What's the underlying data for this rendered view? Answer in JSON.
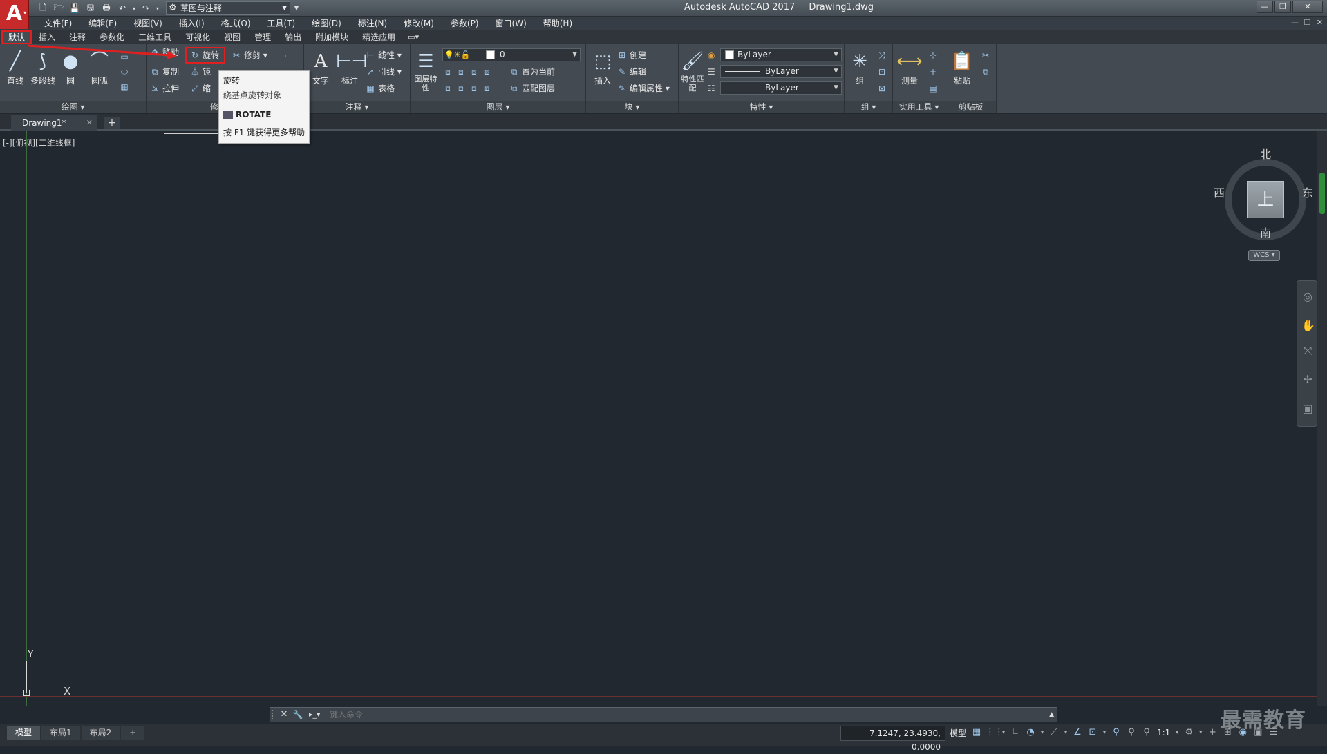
{
  "app": {
    "logo_letter": "A",
    "title": "Autodesk AutoCAD 2017",
    "file": "Drawing1.dwg",
    "workspace": "草图与注释"
  },
  "menu": [
    "文件(F)",
    "编辑(E)",
    "视图(V)",
    "插入(I)",
    "格式(O)",
    "工具(T)",
    "绘图(D)",
    "标注(N)",
    "修改(M)",
    "参数(P)",
    "窗口(W)",
    "帮助(H)"
  ],
  "ribbon_tabs": [
    "默认",
    "插入",
    "注释",
    "参数化",
    "三维工具",
    "可视化",
    "视图",
    "管理",
    "输出",
    "附加模块",
    "精选应用"
  ],
  "ribbon": {
    "draw": {
      "title": "绘图",
      "line": "直线",
      "polyline": "多段线",
      "circle": "圆",
      "arc": "圆弧"
    },
    "modify": {
      "title": "修",
      "move": "移动",
      "rotate": "旋转",
      "trim": "修剪",
      "copy": "复制",
      "mirror": "镜",
      "stretch": "拉伸",
      "scale": "缩"
    },
    "annotation": {
      "title": "注释",
      "text": "文字",
      "dimension": "标注",
      "linear": "线性",
      "leader": "引线",
      "table": "表格"
    },
    "layers": {
      "title": "图层",
      "layer_props": "图层特性",
      "current_layer": "0",
      "set_current": "置为当前",
      "match_layer": "匹配图层"
    },
    "block": {
      "title": "块",
      "insert": "插入",
      "create": "创建",
      "edit": "编辑",
      "edit_attr": "编辑属性"
    },
    "properties": {
      "title": "特性",
      "match": "特性匹配",
      "color": "ByLayer",
      "linetype": "ByLayer",
      "lineweight": "ByLayer"
    },
    "groups": {
      "title": "组",
      "group": "组"
    },
    "utilities": {
      "title": "实用工具",
      "measure": "测量"
    },
    "clipboard": {
      "title": "剪贴板",
      "paste": "粘贴"
    }
  },
  "tooltip": {
    "title": "旋转",
    "description": "绕基点旋转对象",
    "command": "ROTATE",
    "help": "按 F1 键获得更多帮助"
  },
  "doc_tab": {
    "name": "Drawing1*"
  },
  "viewport": {
    "label": "[-][俯视][二维线框]",
    "y_label": "Y",
    "x_label": "X"
  },
  "viewcube": {
    "north": "北",
    "south": "南",
    "east": "东",
    "west": "西",
    "face": "上",
    "wcs": "WCS"
  },
  "command": {
    "placeholder": "键入命令"
  },
  "status": {
    "layouts": [
      "模型",
      "布局1",
      "布局2"
    ],
    "coords": "7.1247, 23.4930, 0.0000",
    "model": "模型",
    "scale": "1:1"
  },
  "watermark": "最需教育"
}
